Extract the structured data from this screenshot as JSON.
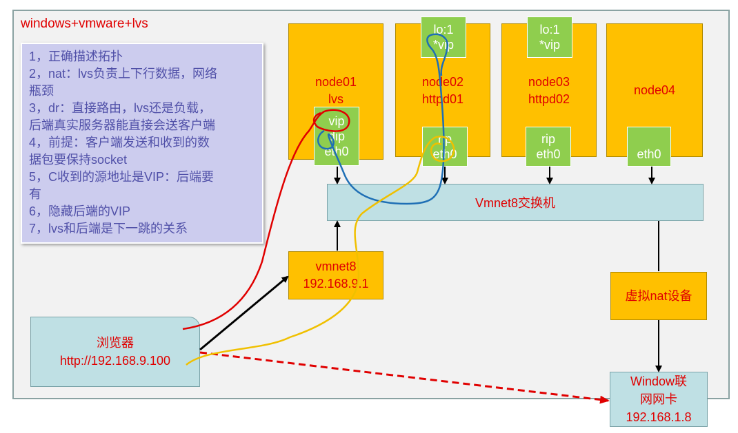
{
  "title": "windows+vmware+lvs",
  "notes": [
    "1，正确描述拓扑",
    "2，nat：lvs负责上下行数据，网络",
    "瓶颈",
    "3，dr：直接路由，lvs还是负载，",
    "后端真实服务器能直接会送客户端",
    "4，前提：客户端发送和收到的数",
    "据包要保持socket",
    "5，C收到的源地址是VIP：后端要",
    "有",
    "6，隐藏后端的VIP",
    "7，lvs和后端是下一跳的关系"
  ],
  "node01": {
    "name": "node01",
    "role": "lvs",
    "if1": "vip",
    "if2": "dip",
    "if3": "eth0"
  },
  "node02": {
    "name": "node02",
    "role": "httpd01",
    "lo1": "lo:1",
    "lo2": "*vip",
    "if1": "rip",
    "if2": "eth0"
  },
  "node03": {
    "name": "node03",
    "role": "httpd02",
    "lo1": "lo:1",
    "lo2": "*vip",
    "if1": "rip",
    "if2": "eth0"
  },
  "node04": {
    "name": "node04",
    "if1": "eth0"
  },
  "switch": "Vmnet8交换机",
  "vmnet8": {
    "name": "vmnet8",
    "ip": "192.168.9.1"
  },
  "nat_device": "虚拟nat设备",
  "browser": {
    "name": "浏览器",
    "url": "http://192.168.9.100"
  },
  "nic": {
    "line1": "Window联",
    "line2": "网网卡",
    "ip": "192.168.1.8"
  }
}
